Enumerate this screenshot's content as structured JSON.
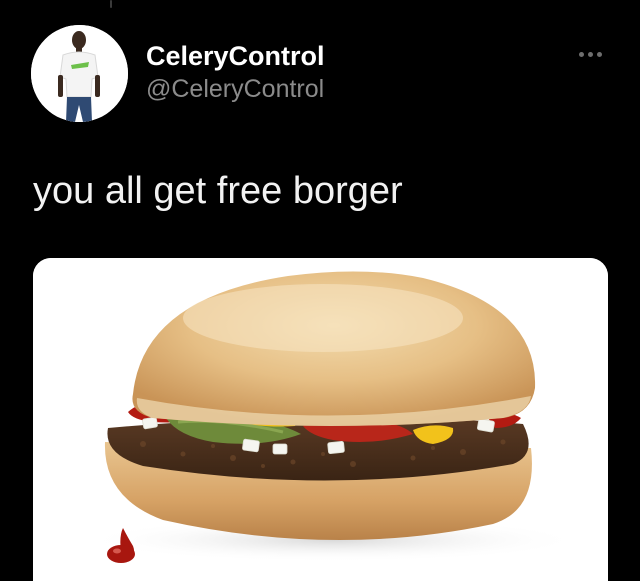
{
  "tweet": {
    "author": {
      "display_name": "CeleryControl",
      "handle": "@CeleryControl"
    },
    "text": "you all get free borger",
    "media": {
      "description_icon": "hamburger-photo"
    }
  },
  "icons": {
    "more": "more-horizontal-icon",
    "avatar": "user-avatar"
  },
  "colors": {
    "background": "#000000",
    "primary_text": "#ffffff",
    "secondary_text": "#8b8b8b",
    "media_background": "#ffffff"
  }
}
